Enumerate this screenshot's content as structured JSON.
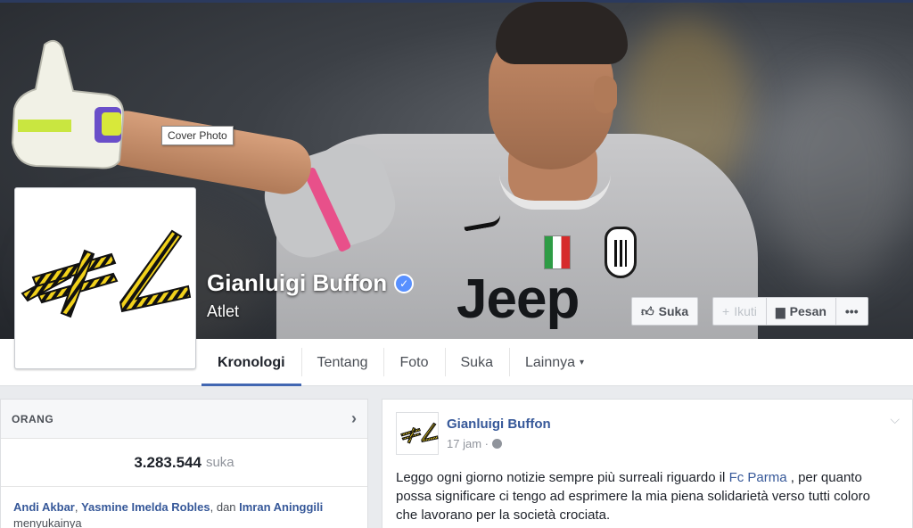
{
  "cover": {
    "tooltip": "Cover Photo",
    "jersey_text": "Jeep"
  },
  "page": {
    "name": "Gianluigi Buffon",
    "category": "Atlet",
    "verified_icon": "verified-badge-icon"
  },
  "actions": {
    "like": "Suka",
    "follow": "Ikuti",
    "message": "Pesan",
    "more": "•••"
  },
  "nav": {
    "items": [
      {
        "label": "Kronologi",
        "active": true
      },
      {
        "label": "Tentang"
      },
      {
        "label": "Foto"
      },
      {
        "label": "Suka"
      },
      {
        "label": "Lainnya"
      }
    ],
    "more_caret": "▾"
  },
  "people": {
    "title": "ORANG",
    "likes_count": "3.283.544",
    "likes_unit": "suka",
    "friend1": "Andi Akbar",
    "friend2": "Yasmine Imelda Robles",
    "friends_joiner": ", dan ",
    "friend3": "Imran Aninggili",
    "friends_suffix": "menyukainya"
  },
  "post": {
    "author": "Gianluigi Buffon",
    "time": "17 jam ·",
    "text_before": "Leggo ogni giorno notizie sempre più surreali riguardo il ",
    "link": "Fc Parma",
    "text_after": " , per quanto possa significare ci tengo ad esprimere la mia piena solidarietà verso tutti coloro che lavorano per la società crociata."
  },
  "colors": {
    "brand": "#4267b2",
    "link": "#365899",
    "logo_yellow": "#f2d21b"
  }
}
